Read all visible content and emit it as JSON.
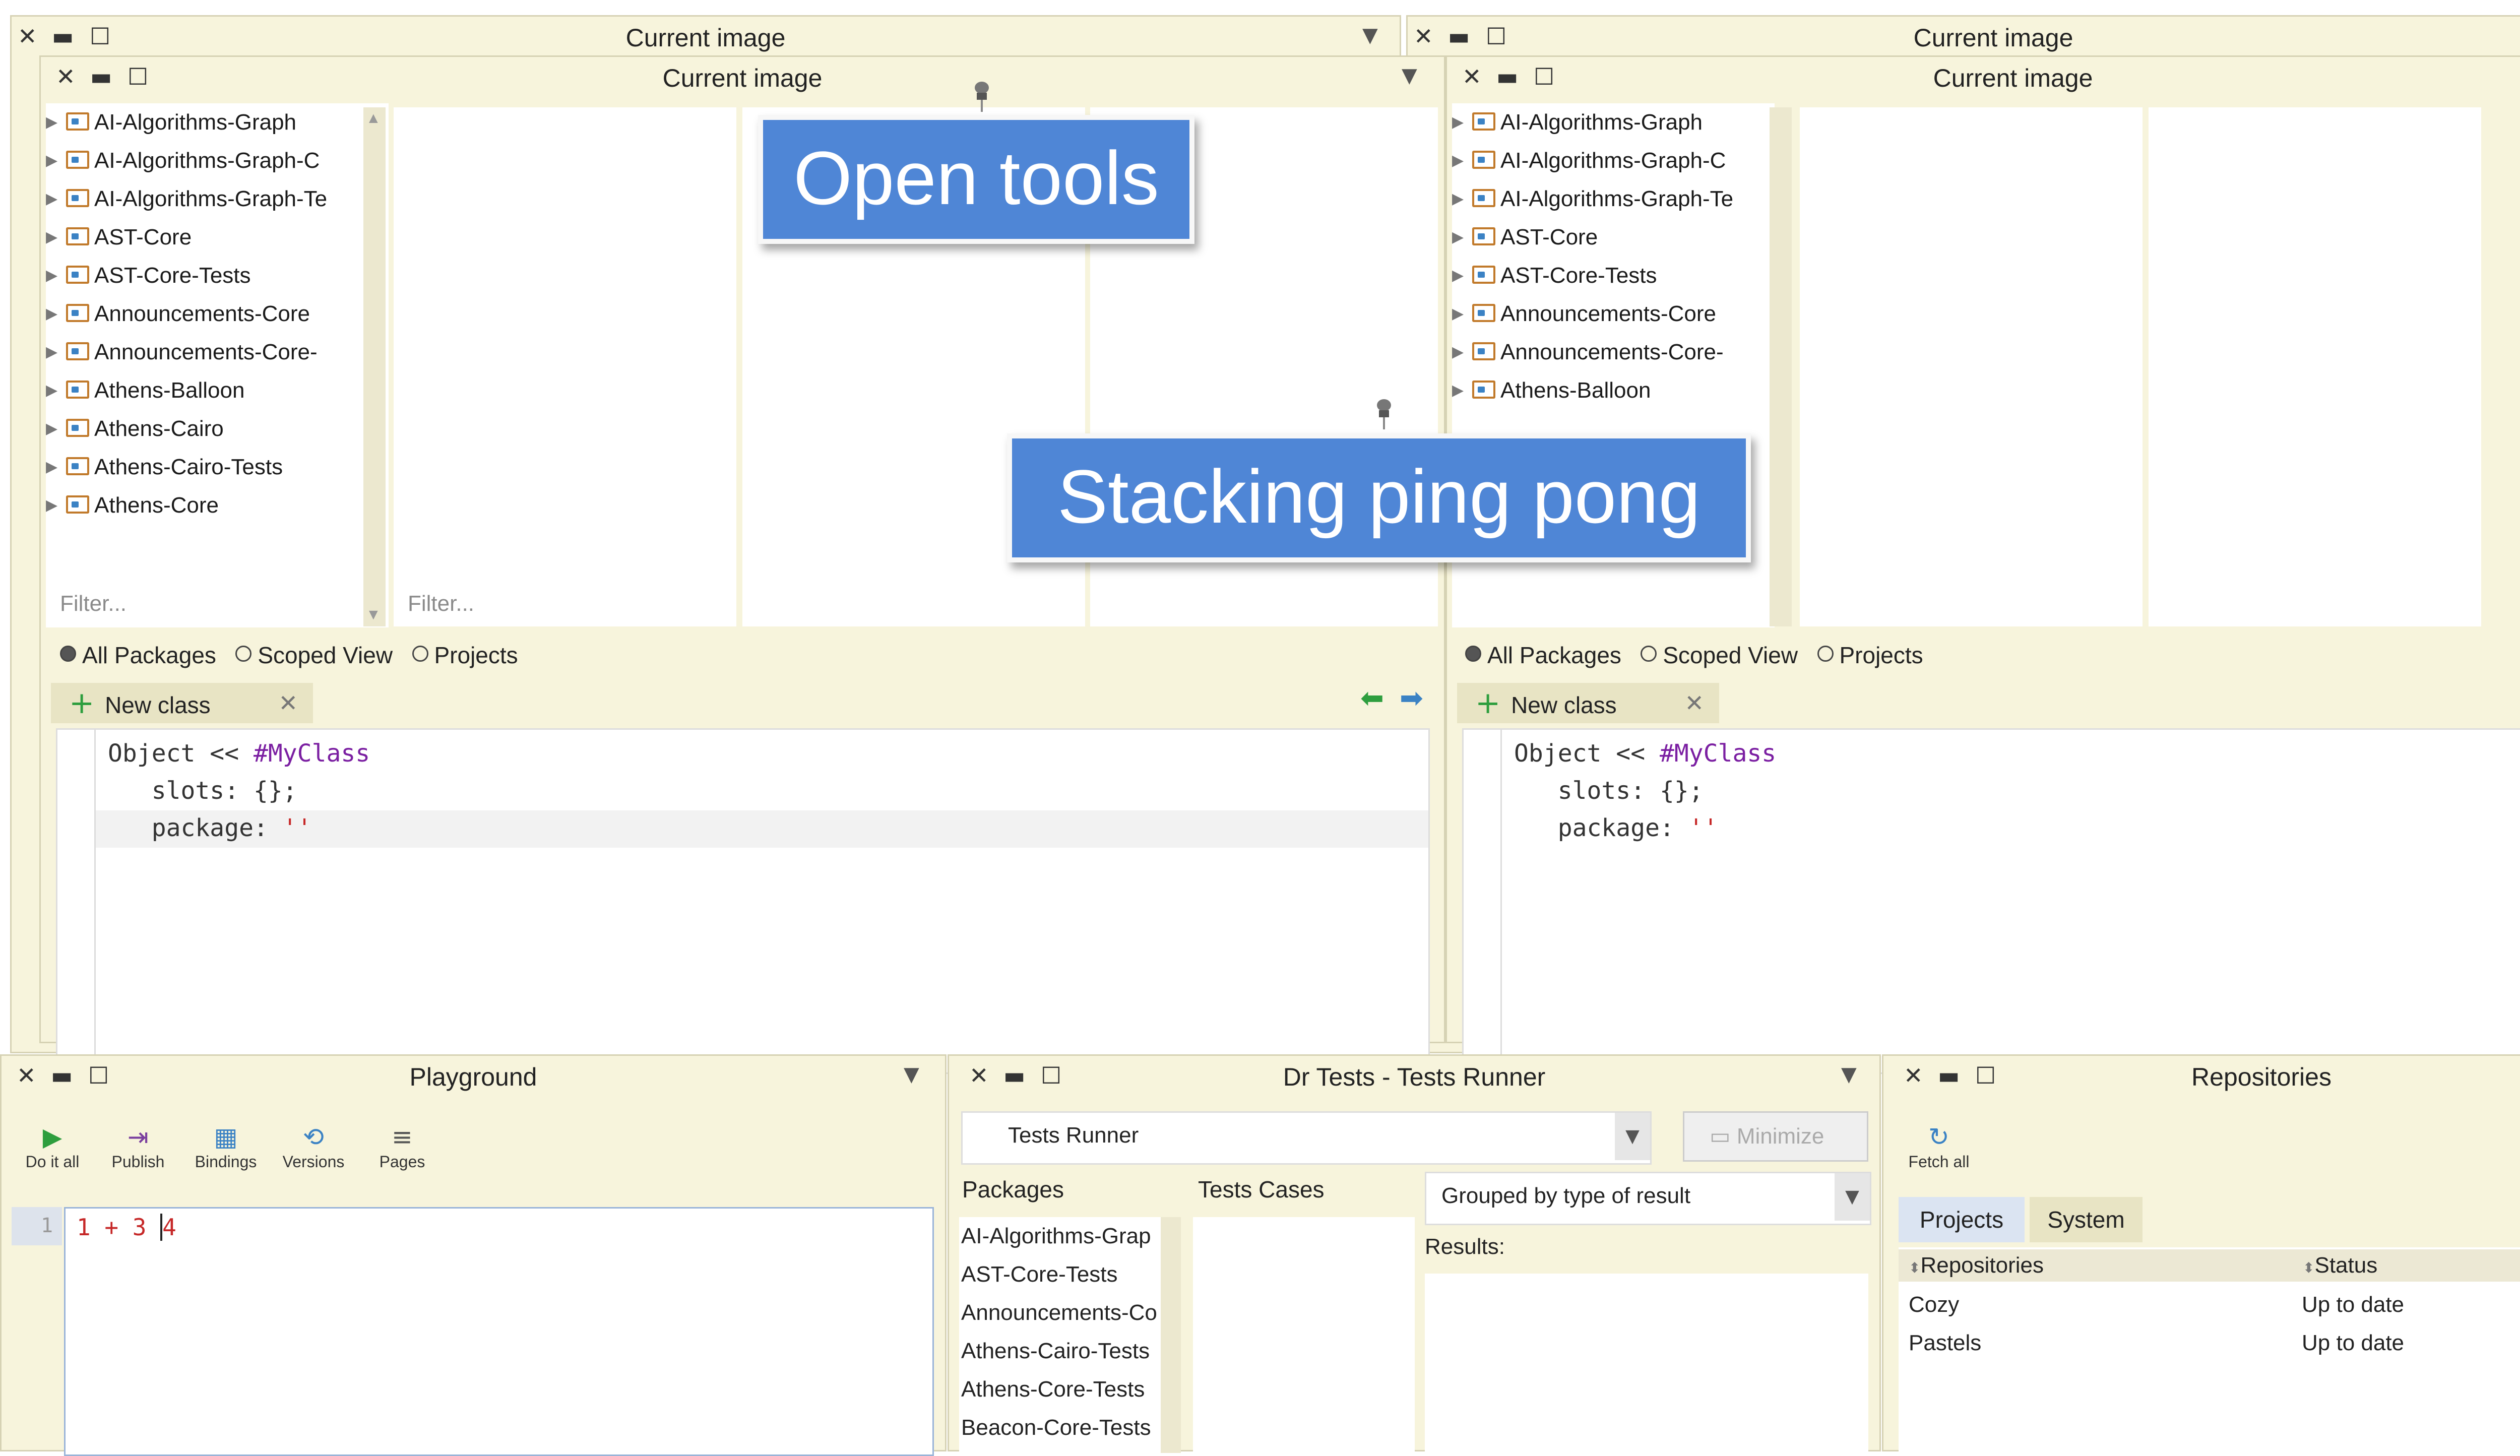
{
  "window_title": "Current image",
  "packages": [
    "AI-Algorithms-Graph",
    "AI-Algorithms-Graph-C",
    "AI-Algorithms-Graph-Te",
    "AST-Core",
    "AST-Core-Tests",
    "Announcements-Core",
    "Announcements-Core-",
    "Athens-Balloon",
    "Athens-Cairo",
    "Athens-Cairo-Tests",
    "Athens-Core"
  ],
  "filter_placeholder": "Filter...",
  "scope": {
    "all": "All Packages",
    "scoped": "Scoped View",
    "projects": "Projects"
  },
  "new_class_tab": "New class",
  "code": {
    "line1_a": "Object << ",
    "line1_b": "#MyClass",
    "line2": "   slots: {};",
    "line3_a": "   package: ",
    "line3_b": "''"
  },
  "banners": {
    "open_tools": "Open tools",
    "stacking": "Stacking ping pong"
  },
  "playground": {
    "title": "Playground",
    "toolbar": [
      "Do it all",
      "Publish",
      "Bindings",
      "Versions",
      "Pages"
    ],
    "line_number": "1",
    "expr": "1 + 3 ",
    "typed": "4"
  },
  "drtests": {
    "title": "Dr Tests - Tests Runner",
    "runner_select": "Tests Runner",
    "minimize": "Minimize",
    "packages_header": "Packages",
    "cases_header": "Tests Cases",
    "grouped": "Grouped by type of result",
    "results_label": "Results:",
    "packages": [
      "AI-Algorithms-Grap",
      "AST-Core-Tests",
      "Announcements-Co",
      "Athens-Cairo-Tests",
      "Athens-Core-Tests",
      "Beacon-Core-Tests"
    ]
  },
  "repositories": {
    "title": "Repositories",
    "fetch_all": "Fetch all",
    "tabs": [
      "Projects",
      "System"
    ],
    "col_repos": "Repositories",
    "col_status": "Status",
    "rows": [
      {
        "name": "Cozy",
        "status": "Up to date"
      },
      {
        "name": "Pastels",
        "status": "Up to date"
      }
    ]
  },
  "colors": {
    "window_bg": "#f7f4dc",
    "banner": "#4f86d6",
    "keyword": "#7b1fa2",
    "string": "#c62828",
    "green_run": "#2e9e3e"
  }
}
